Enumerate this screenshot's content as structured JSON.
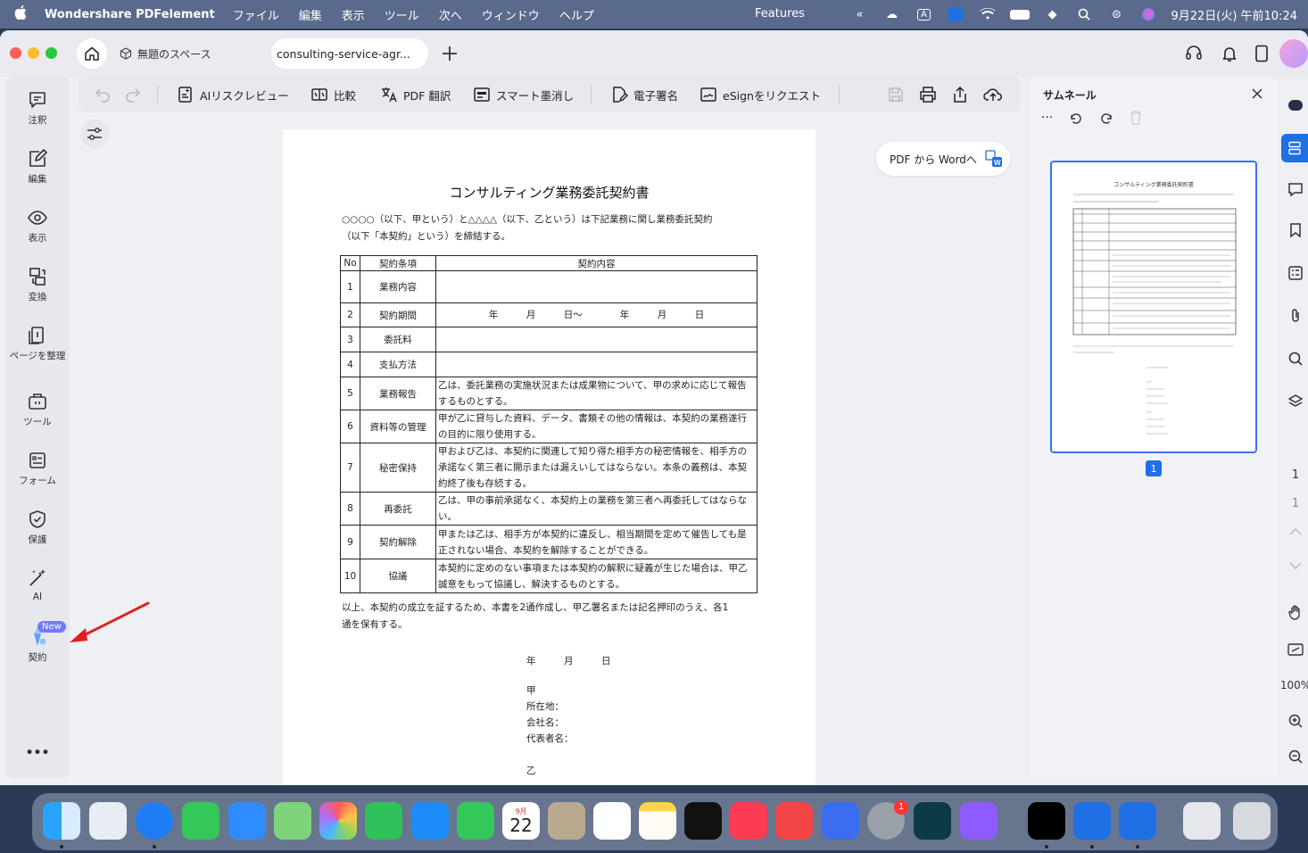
{
  "menubar": {
    "app_name": "Wondershare PDFelement",
    "items": [
      "ファイル",
      "編集",
      "表示",
      "ツール",
      "次へ",
      "ウィンドウ",
      "ヘルプ"
    ],
    "features": "Features",
    "datetime": "9月22日(火) 午前10:24"
  },
  "titlebar": {
    "space_tab": "無題のスペース",
    "doc_tab": "consulting-service-agr..."
  },
  "sidebar": {
    "items": [
      {
        "label": "注釈",
        "icon": "comment-icon"
      },
      {
        "label": "編集",
        "icon": "edit-icon"
      },
      {
        "label": "表示",
        "icon": "eye-icon"
      },
      {
        "label": "変換",
        "icon": "convert-icon"
      },
      {
        "label": "ページを整理",
        "icon": "pages-icon"
      },
      {
        "label": "ツール",
        "icon": "toolbox-icon"
      },
      {
        "label": "フォーム",
        "icon": "form-icon"
      },
      {
        "label": "保護",
        "icon": "shield-icon"
      },
      {
        "label": "AI",
        "icon": "magic-wand-icon"
      },
      {
        "label": "契約",
        "icon": "contract-icon"
      }
    ],
    "new_badge": "New",
    "more": "•••"
  },
  "toolbar": {
    "ai_risk": "AIリスクレビュー",
    "compare": "比較",
    "translate": "PDF 翻訳",
    "redact": "スマート墨消し",
    "sign": "電子署名",
    "esign": "eSignをリクエスト"
  },
  "pdf_to_word": "PDF から Wordへ",
  "document": {
    "title": "コンサルティング業務委託契約書",
    "intro_1": "○○○○（以下、甲という）と△△△△（以下、乙という）は下記業務に関し業務委託契約",
    "intro_2": "（以下「本契約」という）を締結する。",
    "headers": [
      "No",
      "契約条項",
      "契約内容"
    ],
    "rows": [
      {
        "no": "1",
        "term": "業務内容",
        "content": ""
      },
      {
        "no": "2",
        "term": "契約期間",
        "content": "年　　　月　　　日〜　　　　年　　　月　　　日"
      },
      {
        "no": "3",
        "term": "委託料",
        "content": ""
      },
      {
        "no": "4",
        "term": "支払方法",
        "content": ""
      },
      {
        "no": "5",
        "term": "業務報告",
        "content": "乙は、委託業務の実施状況または成果物について、甲の求めに応じて報告するものとする。"
      },
      {
        "no": "6",
        "term": "資料等の管理",
        "content": "甲が乙に貸与した資料、データ、書類その他の情報は、本契約の業務遂行の目的に限り使用する。"
      },
      {
        "no": "7",
        "term": "秘密保持",
        "content": "甲および乙は、本契約に関連して知り得た相手方の秘密情報を、相手方の承諾なく第三者に開示または漏えいしてはならない。本条の義務は、本契約終了後も存続する。"
      },
      {
        "no": "8",
        "term": "再委託",
        "content": "乙は、甲の事前承諾なく、本契約上の業務を第三者へ再委託してはならない。"
      },
      {
        "no": "9",
        "term": "契約解除",
        "content": "甲または乙は、相手方が本契約に違反し、相当期間を定めて催告しても是正されない場合、本契約を解除することができる。"
      },
      {
        "no": "10",
        "term": "協議",
        "content": "本契約に定めのない事項または本契約の解釈に疑義が生じた場合は、甲乙誠意をもって協議し、解決するものとする。"
      }
    ],
    "closing_1": "以上、本契約の成立を証するため、本書を2通作成し、甲乙署名または記名押印のうえ、各1",
    "closing_2": "通を保有する。",
    "date_line": "年　　　月　　　日",
    "party_a": "甲",
    "address": "所在地：",
    "company": "会社名：",
    "representative": "代表者名：",
    "party_b": "乙"
  },
  "thumbnail": {
    "title": "サムネール",
    "page_number": "1",
    "mini_title": "コンサルティング業務委託契約書"
  },
  "rail": {
    "current_page": "1",
    "total_pages": "1",
    "zoom": "100%"
  },
  "dock": {
    "calendar_day": "22",
    "calendar_month": "9月",
    "badge": "1"
  },
  "colors": {
    "accent": "#1f6fe5",
    "menubar": "#5a6a8c",
    "arrow": "#e02020"
  }
}
